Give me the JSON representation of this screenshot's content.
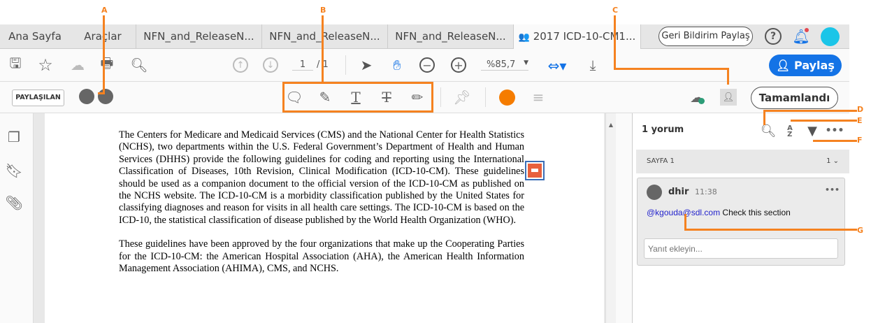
{
  "tabs": {
    "home": "Ana Sayfa",
    "tools": "Araçlar",
    "docs": [
      "NFN_and_ReleaseN...",
      "NFN_and_ReleaseN...",
      "NFN_and_ReleaseN..."
    ],
    "active": "2017 ICD-10-CM1...",
    "close": "×"
  },
  "header": {
    "feedback": "Geri Bildirim Paylaş",
    "share": "Paylaş"
  },
  "toolbar": {
    "page_current": "1",
    "page_total": "/ 1",
    "zoom": "%85,7"
  },
  "subbar": {
    "shared_badge": "PAYLAŞILAN",
    "done": "Tamamlandı",
    "accent_color": "#f57c00"
  },
  "document": {
    "paragraphs": [
      "The Centers for Medicare and Medicaid Services (CMS) and the National Center for Health Statistics (NCHS), two departments within the U.S. Federal Government’s Department of Health and Human Services (DHHS) provide the following guidelines for coding and reporting using the International Classification of Diseases, 10th Revision, Clinical Modification (ICD-10-CM). These guidelines should be used as a companion document to the official version of the ICD-10-CM as published on the NCHS website. The ICD-10-CM is a morbidity classification published by the United States for classifying diagnoses and reason for visits in all health care settings.  The ICD-10-CM is based on the ICD-10, the statistical classification of disease published by the World Health Organization (WHO).",
      "These guidelines have been approved by the four organizations that make up the Cooperating Parties for the ICD-10-CM: the American Hospital Association (AHA), the American Health Information Management Association (AHIMA), CMS, and NCHS."
    ]
  },
  "comments": {
    "count": "1 yorum",
    "page_label": "SAYFA 1",
    "page_count": "1",
    "author": "dhir",
    "time": "11:38",
    "mention": "@kgouda@sdl.com",
    "text": " Check this section",
    "reply_placeholder": "Yanıt ekleyin..."
  },
  "callouts": {
    "a": "A",
    "b": "B",
    "c": "C",
    "d": "D",
    "e": "E",
    "f": "F",
    "g": "G"
  }
}
